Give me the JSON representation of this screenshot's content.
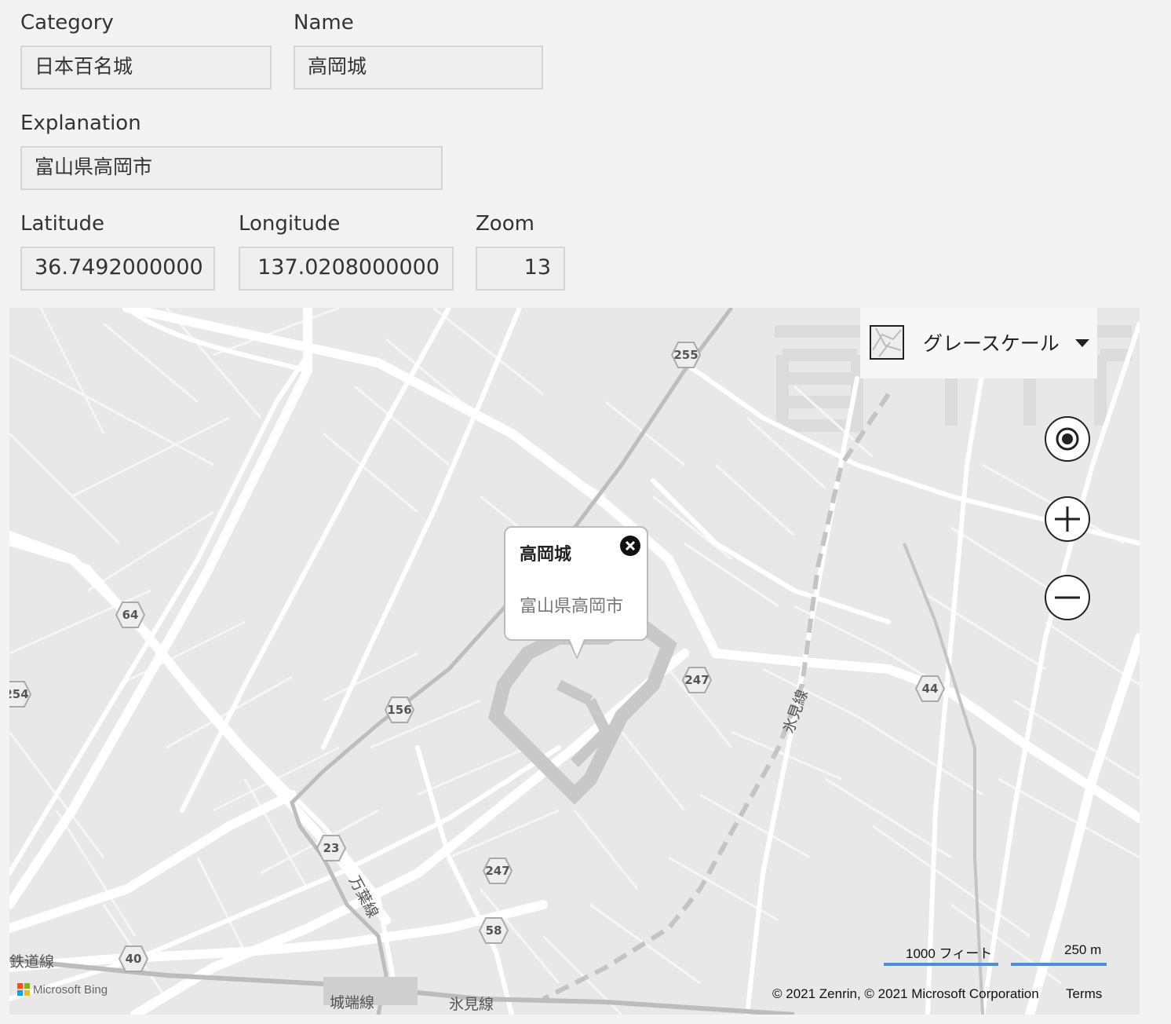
{
  "form": {
    "category": {
      "label": "Category",
      "value": "日本百名城"
    },
    "name": {
      "label": "Name",
      "value": "高岡城"
    },
    "explanation": {
      "label": "Explanation",
      "value": "富山県高岡市"
    },
    "latitude": {
      "label": "Latitude",
      "value": "36.7492000000"
    },
    "longitude": {
      "label": "Longitude",
      "value": "137.0208000000"
    },
    "zoom": {
      "label": "Zoom",
      "value": "13"
    }
  },
  "map": {
    "style_picker": {
      "label": "グレースケール",
      "icon": "map-style-thumbnail"
    },
    "controls": [
      {
        "name": "locate-me-icon"
      },
      {
        "name": "zoom-in-icon"
      },
      {
        "name": "zoom-out-icon"
      }
    ],
    "popup": {
      "title": "高岡城",
      "description": "富山県高岡市"
    },
    "route_shields": [
      "255",
      "64",
      "254",
      "156",
      "247",
      "247",
      "44",
      "23",
      "58",
      "40"
    ],
    "line_labels": [
      "氷見線",
      "万葉線",
      "城端線",
      "氷見線",
      "鉄道線"
    ],
    "scale": {
      "imperial": "1000 フィート",
      "metric": "250 m"
    },
    "copyright": "© 2021 Zenrin, © 2021 Microsoft Corporation",
    "terms": "Terms",
    "provider": "Microsoft Bing",
    "colors": {
      "scale_bar": "#4a90e2",
      "background": "#e8e8e8",
      "roads": "#ffffff",
      "castle": "#c8c8c8"
    }
  }
}
